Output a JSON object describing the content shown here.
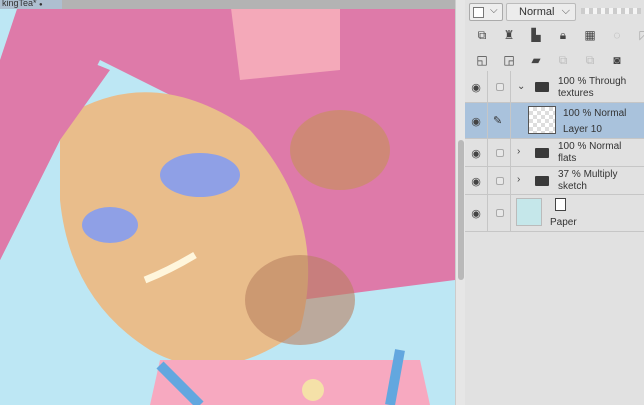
{
  "document_tab": {
    "title": "kingTea*",
    "close": "●"
  },
  "layer_panel": {
    "swatch_chevron": "⌵",
    "blend_mode": "Normal",
    "blend_chevron": "⌵",
    "layers": [
      {
        "opacity_mode": "100 % Through",
        "name": "textures",
        "type": "folder",
        "expanded": true,
        "selected": false
      },
      {
        "opacity_mode": "100 % Normal",
        "name": "Layer 10",
        "type": "raster",
        "selected": true
      },
      {
        "opacity_mode": "100 % Normal",
        "name": "flats",
        "type": "folder",
        "expanded": false,
        "selected": false
      },
      {
        "opacity_mode": "37 % Multiply",
        "name": "sketch",
        "type": "folder",
        "expanded": false,
        "selected": false
      },
      {
        "name": "Paper",
        "type": "paper",
        "color": "#c5e7ea",
        "selected": false
      }
    ]
  },
  "colors": {
    "hair": "#de7aa9",
    "skin": "#e9bd8b",
    "sky": "#bde7f4",
    "selection": "#a9c2dc"
  }
}
